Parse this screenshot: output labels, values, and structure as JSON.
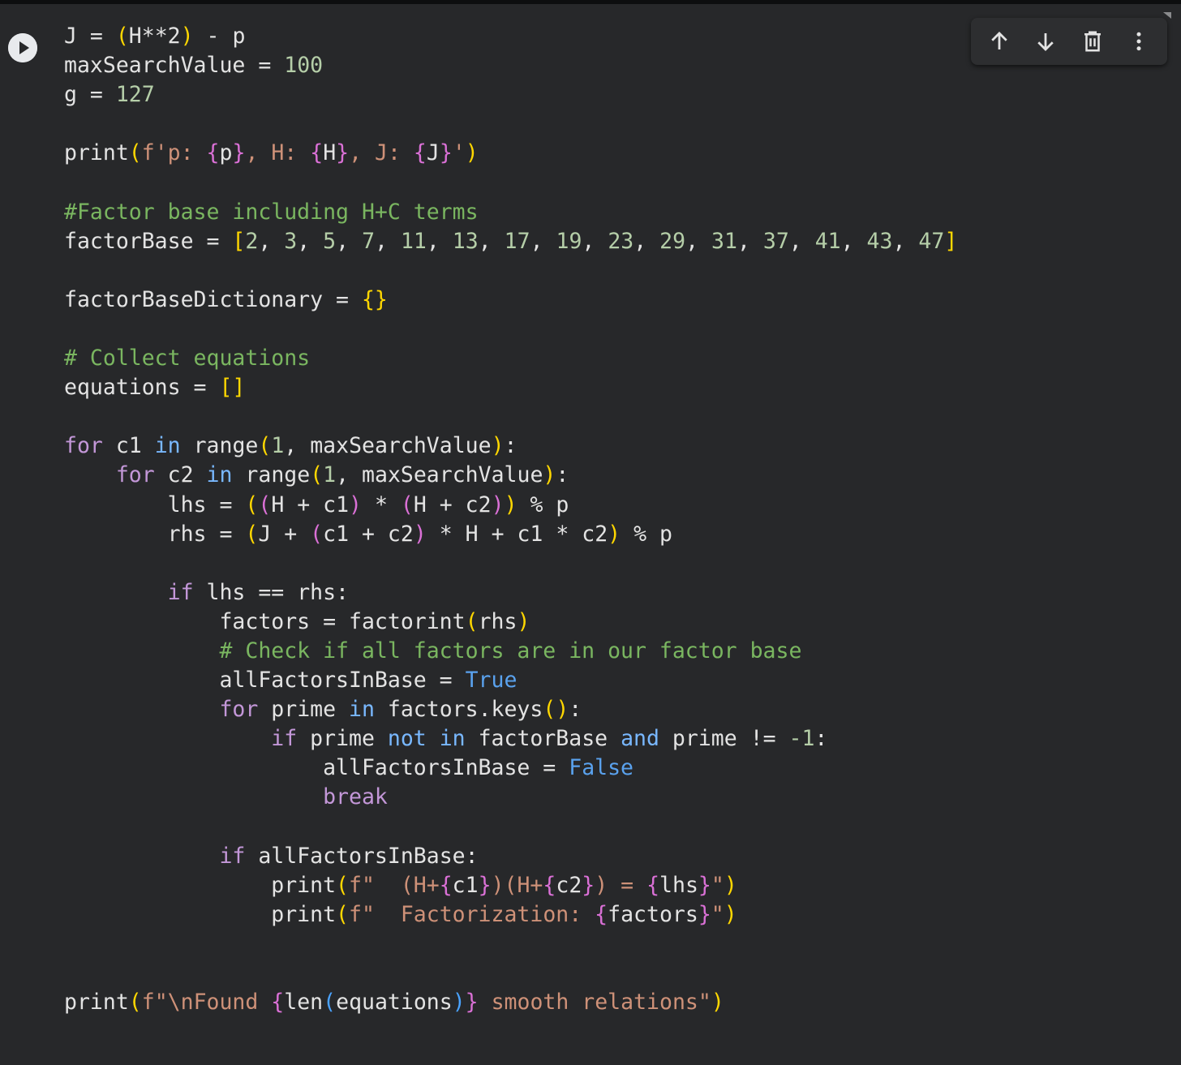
{
  "toolbar": {
    "buttons": [
      {
        "name": "move-cell-up",
        "icon": "arrow-up-icon"
      },
      {
        "name": "move-cell-down",
        "icon": "arrow-down-icon"
      },
      {
        "name": "delete-cell",
        "icon": "trash-icon"
      },
      {
        "name": "more-actions",
        "icon": "more-vert-icon"
      }
    ]
  },
  "run_button": {
    "icon": "play-icon"
  },
  "colors": {
    "background": "#27282a",
    "keyword": "#c397d8",
    "operator_word": "#79b8ff",
    "boolean": "#5aa2ee",
    "number": "#b5cea8",
    "comment": "#7ab660",
    "string": "#ce9178",
    "bracket_level1": "#ffd700",
    "bracket_level2": "#da70d6",
    "bracket_level3": "#4aa3ff"
  },
  "code": [
    [
      [
        "plain",
        "J = "
      ],
      [
        "b1",
        "("
      ],
      [
        "plain",
        "H**2"
      ],
      [
        "b1",
        ")"
      ],
      [
        "plain",
        " - p"
      ]
    ],
    [
      [
        "plain",
        "maxSearchValue = "
      ],
      [
        "num",
        "100"
      ]
    ],
    [
      [
        "plain",
        "g = "
      ],
      [
        "num",
        "127"
      ]
    ],
    [],
    [
      [
        "plain",
        "print"
      ],
      [
        "b1",
        "("
      ],
      [
        "str",
        "f'p: "
      ],
      [
        "b2",
        "{"
      ],
      [
        "plain",
        "p"
      ],
      [
        "b2",
        "}"
      ],
      [
        "str",
        ", H: "
      ],
      [
        "b2",
        "{"
      ],
      [
        "plain",
        "H"
      ],
      [
        "b2",
        "}"
      ],
      [
        "str",
        ", J: "
      ],
      [
        "b2",
        "{"
      ],
      [
        "plain",
        "J"
      ],
      [
        "b2",
        "}"
      ],
      [
        "str",
        "'"
      ],
      [
        "b1",
        ")"
      ]
    ],
    [],
    [
      [
        "com",
        "#Factor base including H+C terms"
      ]
    ],
    [
      [
        "plain",
        "factorBase = "
      ],
      [
        "b1",
        "["
      ],
      [
        "num",
        "2"
      ],
      [
        "plain",
        ", "
      ],
      [
        "num",
        "3"
      ],
      [
        "plain",
        ", "
      ],
      [
        "num",
        "5"
      ],
      [
        "plain",
        ", "
      ],
      [
        "num",
        "7"
      ],
      [
        "plain",
        ", "
      ],
      [
        "num",
        "11"
      ],
      [
        "plain",
        ", "
      ],
      [
        "num",
        "13"
      ],
      [
        "plain",
        ", "
      ],
      [
        "num",
        "17"
      ],
      [
        "plain",
        ", "
      ],
      [
        "num",
        "19"
      ],
      [
        "plain",
        ", "
      ],
      [
        "num",
        "23"
      ],
      [
        "plain",
        ", "
      ],
      [
        "num",
        "29"
      ],
      [
        "plain",
        ", "
      ],
      [
        "num",
        "31"
      ],
      [
        "plain",
        ", "
      ],
      [
        "num",
        "37"
      ],
      [
        "plain",
        ", "
      ],
      [
        "num",
        "41"
      ],
      [
        "plain",
        ", "
      ],
      [
        "num",
        "43"
      ],
      [
        "plain",
        ", "
      ],
      [
        "num",
        "47"
      ],
      [
        "b1",
        "]"
      ]
    ],
    [],
    [
      [
        "plain",
        "factorBaseDictionary = "
      ],
      [
        "b1",
        "{}"
      ]
    ],
    [],
    [
      [
        "com",
        "# Collect equations"
      ]
    ],
    [
      [
        "plain",
        "equations = "
      ],
      [
        "b1",
        "[]"
      ]
    ],
    [],
    [
      [
        "kw",
        "for"
      ],
      [
        "plain",
        " c1 "
      ],
      [
        "op",
        "in"
      ],
      [
        "plain",
        " range"
      ],
      [
        "b1",
        "("
      ],
      [
        "num",
        "1"
      ],
      [
        "plain",
        ", maxSearchValue"
      ],
      [
        "b1",
        ")"
      ],
      [
        "plain",
        ":"
      ]
    ],
    [
      [
        "plain",
        "    "
      ],
      [
        "kw",
        "for"
      ],
      [
        "plain",
        " c2 "
      ],
      [
        "op",
        "in"
      ],
      [
        "plain",
        " range"
      ],
      [
        "b1",
        "("
      ],
      [
        "num",
        "1"
      ],
      [
        "plain",
        ", maxSearchValue"
      ],
      [
        "b1",
        ")"
      ],
      [
        "plain",
        ":"
      ]
    ],
    [
      [
        "plain",
        "        lhs = "
      ],
      [
        "b1",
        "("
      ],
      [
        "b2",
        "("
      ],
      [
        "plain",
        "H + c1"
      ],
      [
        "b2",
        ")"
      ],
      [
        "plain",
        " * "
      ],
      [
        "b2",
        "("
      ],
      [
        "plain",
        "H + c2"
      ],
      [
        "b2",
        ")"
      ],
      [
        "b1",
        ")"
      ],
      [
        "plain",
        " % p"
      ]
    ],
    [
      [
        "plain",
        "        rhs = "
      ],
      [
        "b1",
        "("
      ],
      [
        "plain",
        "J + "
      ],
      [
        "b2",
        "("
      ],
      [
        "plain",
        "c1 + c2"
      ],
      [
        "b2",
        ")"
      ],
      [
        "plain",
        " * H + c1 * c2"
      ],
      [
        "b1",
        ")"
      ],
      [
        "plain",
        " % p"
      ]
    ],
    [],
    [
      [
        "plain",
        "        "
      ],
      [
        "kw",
        "if"
      ],
      [
        "plain",
        " lhs == rhs:"
      ]
    ],
    [
      [
        "plain",
        "            factors = factorint"
      ],
      [
        "b1",
        "("
      ],
      [
        "plain",
        "rhs"
      ],
      [
        "b1",
        ")"
      ]
    ],
    [
      [
        "plain",
        "            "
      ],
      [
        "com",
        "# Check if all factors are in our factor base"
      ]
    ],
    [
      [
        "plain",
        "            allFactorsInBase = "
      ],
      [
        "bool",
        "True"
      ]
    ],
    [
      [
        "plain",
        "            "
      ],
      [
        "kw",
        "for"
      ],
      [
        "plain",
        " prime "
      ],
      [
        "op",
        "in"
      ],
      [
        "plain",
        " factors.keys"
      ],
      [
        "b1",
        "()"
      ],
      [
        "plain",
        ":"
      ]
    ],
    [
      [
        "plain",
        "                "
      ],
      [
        "kw",
        "if"
      ],
      [
        "plain",
        " prime "
      ],
      [
        "op",
        "not in"
      ],
      [
        "plain",
        " factorBase "
      ],
      [
        "op",
        "and"
      ],
      [
        "plain",
        " prime != "
      ],
      [
        "num",
        "-1"
      ],
      [
        "plain",
        ":"
      ]
    ],
    [
      [
        "plain",
        "                    allFactorsInBase = "
      ],
      [
        "bool",
        "False"
      ]
    ],
    [
      [
        "plain",
        "                    "
      ],
      [
        "kw",
        "break"
      ]
    ],
    [],
    [
      [
        "plain",
        "            "
      ],
      [
        "kw",
        "if"
      ],
      [
        "plain",
        " allFactorsInBase:"
      ]
    ],
    [
      [
        "plain",
        "                print"
      ],
      [
        "b1",
        "("
      ],
      [
        "str",
        "f\"  (H+"
      ],
      [
        "b2",
        "{"
      ],
      [
        "plain",
        "c1"
      ],
      [
        "b2",
        "}"
      ],
      [
        "str",
        ")(H+"
      ],
      [
        "b2",
        "{"
      ],
      [
        "plain",
        "c2"
      ],
      [
        "b2",
        "}"
      ],
      [
        "str",
        ") = "
      ],
      [
        "b2",
        "{"
      ],
      [
        "plain",
        "lhs"
      ],
      [
        "b2",
        "}"
      ],
      [
        "str",
        "\""
      ],
      [
        "b1",
        ")"
      ]
    ],
    [
      [
        "plain",
        "                print"
      ],
      [
        "b1",
        "("
      ],
      [
        "str",
        "f\"  Factorization: "
      ],
      [
        "b2",
        "{"
      ],
      [
        "plain",
        "factors"
      ],
      [
        "b2",
        "}"
      ],
      [
        "str",
        "\""
      ],
      [
        "b1",
        ")"
      ]
    ],
    [],
    [],
    [
      [
        "plain",
        "print"
      ],
      [
        "b1",
        "("
      ],
      [
        "str",
        "f\"\\nFound "
      ],
      [
        "b2",
        "{"
      ],
      [
        "plain",
        "len"
      ],
      [
        "b3",
        "("
      ],
      [
        "plain",
        "equations"
      ],
      [
        "b3",
        ")"
      ],
      [
        "b2",
        "}"
      ],
      [
        "str",
        " smooth relations\""
      ],
      [
        "b1",
        ")"
      ]
    ]
  ]
}
